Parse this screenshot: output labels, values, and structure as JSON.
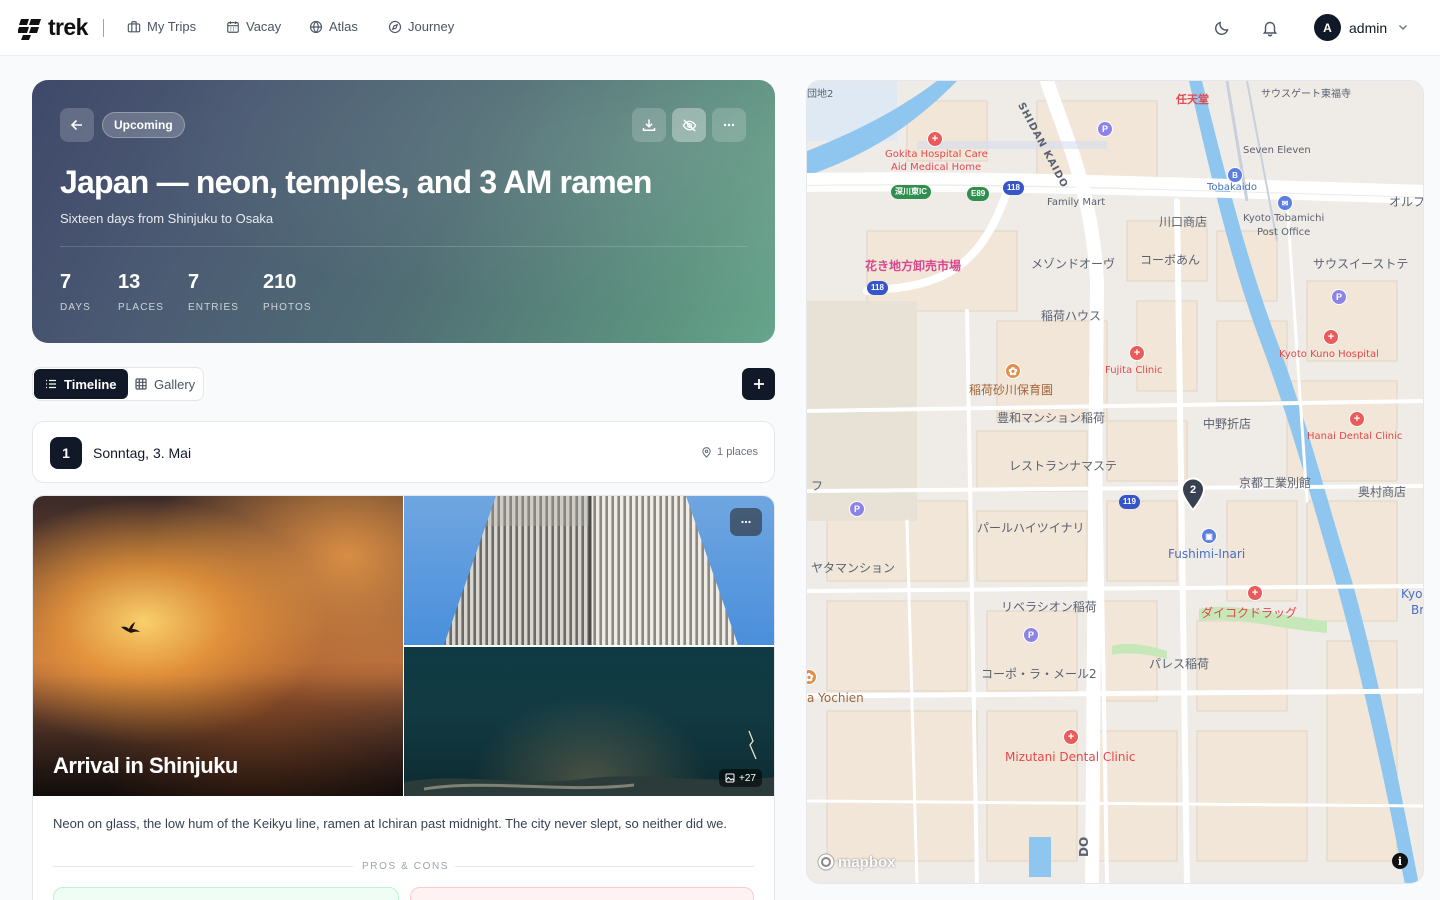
{
  "app": {
    "brand": "trek"
  },
  "nav": {
    "items": [
      {
        "label": "My Trips",
        "icon": "briefcase-icon"
      },
      {
        "label": "Vacay",
        "icon": "calendar-icon"
      },
      {
        "label": "Atlas",
        "icon": "globe-icon"
      },
      {
        "label": "Journey",
        "icon": "compass-icon"
      }
    ],
    "user": {
      "initial": "A",
      "name": "admin"
    }
  },
  "trip": {
    "status": "Upcoming",
    "title": "Japan — neon, temples, and 3 AM ramen",
    "subtitle": "Sixteen days from Shinjuku to Osaka",
    "stats": [
      {
        "value": "7",
        "label": "DAYS"
      },
      {
        "value": "13",
        "label": "PLACES"
      },
      {
        "value": "7",
        "label": "ENTRIES"
      },
      {
        "value": "210",
        "label": "PHOTOS"
      }
    ],
    "gradient": [
      "#3f4869",
      "#67a58c"
    ]
  },
  "view": {
    "timeline": "Timeline",
    "gallery": "Gallery"
  },
  "day": {
    "number": "1",
    "title": "Sonntag, 3. Mai",
    "places": "1 places"
  },
  "entry": {
    "title": "Arrival in Shinjuku",
    "text": "Neon on glass, the low hum of the Keikyu line, ramen at Ichiran past midnight. The city never slept, so neither did we.",
    "more_photos": "+27",
    "section_label": "PROS & CONS"
  },
  "map": {
    "marker": "2",
    "attribution": "mapbox",
    "labels": {
      "nintendo": "任天堂",
      "southgate": "サウスゲート東福寺",
      "gokita": "Gokita Hospital Care",
      "gokita2": "Aid Medical Home",
      "shidan": "SHIDAN KAIDO",
      "sevenEleven": "Seven Eleven",
      "tobakaido": "Tobakaido",
      "familyMart": "Family Mart",
      "kawaguchi": "川口商店",
      "kyotoTobamichi": "Kyoto Tobamichi",
      "postOffice": "Post Office",
      "orufu": "オルフ",
      "hanaki": "花き地方卸売市場",
      "maison": "メゾンドオーヴ",
      "coboan": "コーボあん",
      "southsweet": "サウスイーストテ",
      "inariHouse": "稲荷ハウス",
      "fujita": "Fujita Clinic",
      "kunoHospital": "Kyoto Kuno Hospital",
      "hoikuen": "稲荷砂川保育園",
      "mansion": "豊和マンション稲荷",
      "nakano": "中野折店",
      "hanai": "Hanai Dental Clinic",
      "restaurant": "レストランナマステ",
      "kyotoKogei": "京都工業別館",
      "okumura": "奥村商店",
      "pearl": "パールハイツイナリ",
      "fushimi": "Fushimi-Inari",
      "yamata": "ヤタマンション",
      "liberacion": "リベラシオン稲荷",
      "daikoku": "ダイコクドラッグ",
      "kyoBr": "Kyo",
      "kyoBr2": "Br",
      "coboRa": "コーポ・ラ・メール2",
      "palace": "パレス稲荷",
      "yochien": "a Yochien",
      "mizutani": "Mizutani Dental Clinic",
      "tochi": "団地2",
      "fu": "フ",
      "kawa": "深川東IC",
      "e89": "E89",
      "r118": "118",
      "r119": "119",
      "dd": "DO"
    }
  }
}
